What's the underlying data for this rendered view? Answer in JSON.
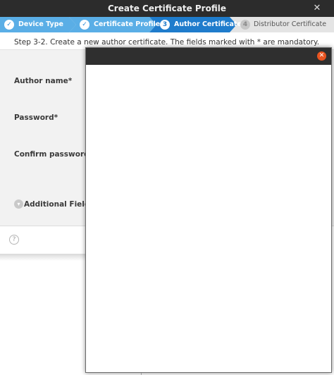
{
  "window": {
    "title": "Create Certificate Profile",
    "close_glyph": "✕"
  },
  "steps": [
    {
      "label": "Device Type",
      "state": "done",
      "icon": "✓"
    },
    {
      "label": "Certificate Profile",
      "state": "done",
      "icon": "✓"
    },
    {
      "label": "Author Certificate",
      "state": "current",
      "icon": "3"
    },
    {
      "label": "Distributor Certificate",
      "state": "pending",
      "icon": "4"
    }
  ],
  "colors": {
    "step_done": "#5aaee6",
    "step_current": "#1f7ccc",
    "step_pending": "#e4e4e4",
    "close_accent": "#e95420"
  },
  "instructions": "Step 3-2. Create a new author certificate. The fields marked with * are mandatory.",
  "form": {
    "author_name_label": "Author name*",
    "password_label": "Password*",
    "confirm_password_label": "Confirm password*",
    "additional_fields_label": "Additional Fields",
    "additional_icon": "chevron-down-icon"
  },
  "footer": {
    "help_glyph": "?"
  },
  "overlay_dialog": {
    "close_glyph": "✕"
  }
}
